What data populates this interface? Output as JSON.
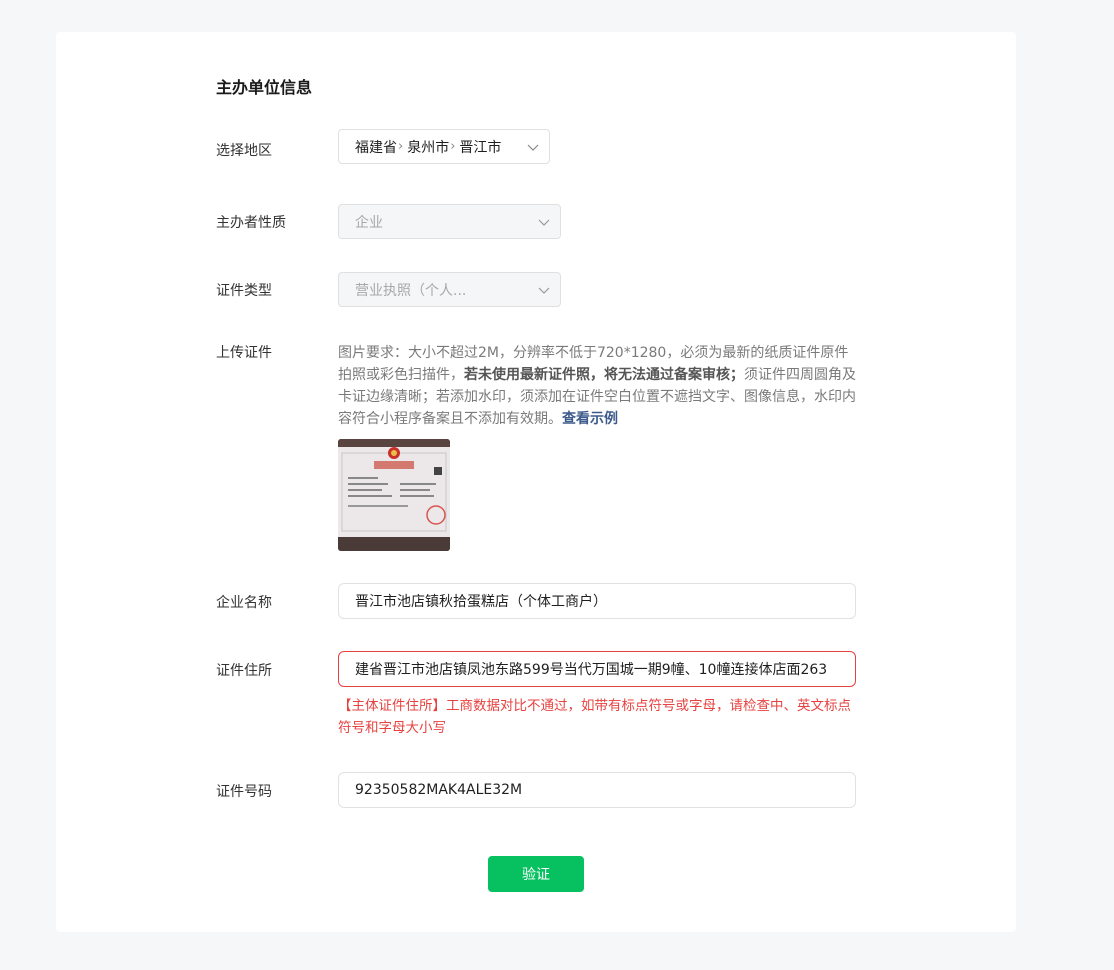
{
  "section": {
    "title": "主办单位信息"
  },
  "fields": {
    "region": {
      "label": "选择地区",
      "province": "福建省",
      "city": "泉州市",
      "district": "晋江市"
    },
    "sponsor_nature": {
      "label": "主办者性质",
      "value": "企业"
    },
    "cert_type": {
      "label": "证件类型",
      "value": "营业执照（个人..."
    },
    "upload": {
      "label": "上传证件",
      "help_part1": "图片要求：大小不超过2M，分辨率不低于720*1280，必须为最新的纸质证件原件拍照或彩色扫描件，",
      "help_bold": "若未使用最新证件照，将无法通过备案审核；",
      "help_part2": "须证件四周圆角及卡证边缘清晰；若添加水印，须添加在证件空白位置不遮挡文字、图像信息，水印内容符合小程序备案且不添加有效期。",
      "help_link": "查看示例"
    },
    "company_name": {
      "label": "企业名称",
      "value": "晋江市池店镇秋拾蛋糕店（个体工商户）"
    },
    "cert_address": {
      "label": "证件住所",
      "value": "建省晋江市池店镇凤池东路599号当代万国城一期9幢、10幢连接体店面263",
      "error": "【主体证件住所】工商数据对比不通过，如带有标点符号或字母，请检查中、英文标点符号和字母大小写"
    },
    "cert_number": {
      "label": "证件号码",
      "value": "92350582MAK4ALE32M"
    }
  },
  "actions": {
    "verify_label": "验证"
  },
  "colors": {
    "primary": "#07c160",
    "error": "#e64340",
    "link": "#3d5a8a"
  }
}
